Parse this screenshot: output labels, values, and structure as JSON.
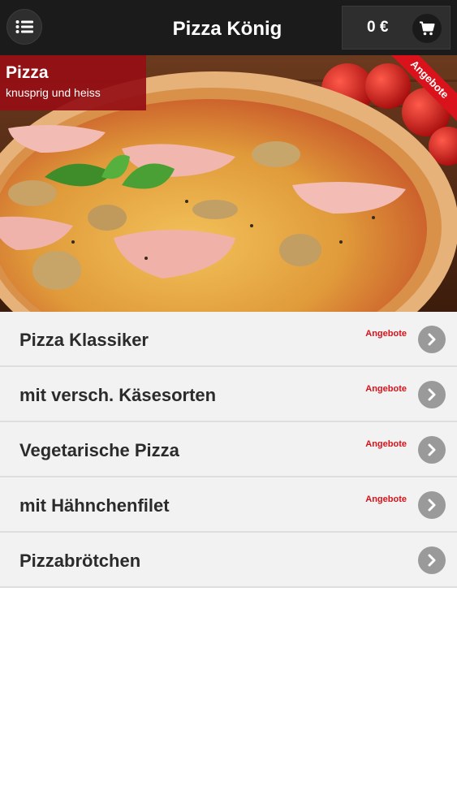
{
  "header": {
    "title": "Pizza König",
    "menu_icon": "list-menu-icon",
    "cart": {
      "total": "0 €",
      "icon": "cart-icon"
    }
  },
  "banner": {
    "category_title": "Pizza",
    "category_subtitle": "knusprig und heiss",
    "ribbon_label": "Angebote"
  },
  "menu_items": [
    {
      "label": "Pizza Klassiker",
      "badge": "Angebote"
    },
    {
      "label": "mit versch. Käsesorten",
      "badge": "Angebote"
    },
    {
      "label": "Vegetarische Pizza",
      "badge": "Angebote"
    },
    {
      "label": "mit Hähnchenfilet",
      "badge": "Angebote"
    },
    {
      "label": "Pizzabrötchen",
      "badge": ""
    }
  ],
  "colors": {
    "topbar": "#1b1b1b",
    "accent_red": "#d4141c",
    "category_red": "#960e14",
    "list_bg": "#f2f2f2",
    "arrow_grey": "#9a9a9a"
  }
}
